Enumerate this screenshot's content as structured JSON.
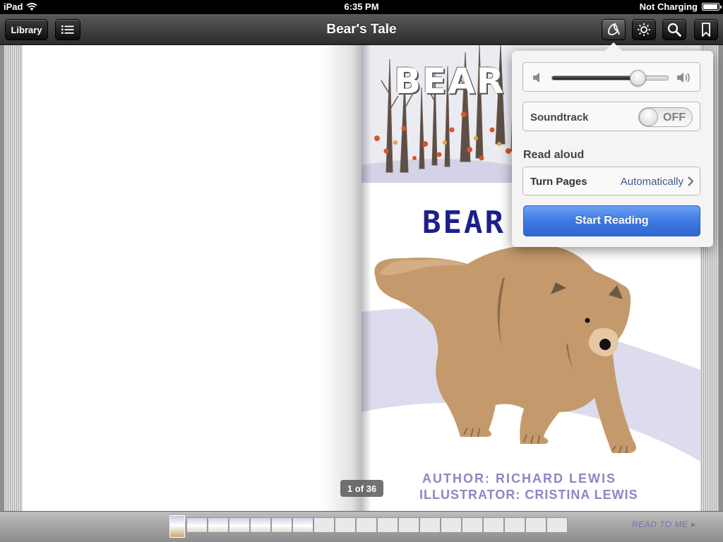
{
  "status_bar": {
    "device": "iPad",
    "time": "6:35 PM",
    "battery_status": "Not Charging"
  },
  "toolbar": {
    "library_label": "Library",
    "book_title": "Bear's Tale",
    "icons": [
      "list-icon",
      "audio-icon",
      "brightness-icon",
      "search-icon",
      "bookmark-icon"
    ]
  },
  "book": {
    "cover_title_top": "BEAR",
    "cover_title_main": "BEAR",
    "author": "AUTHOR: RICHARD LEWIS",
    "illustrator": "ILLUSTRATOR: CRISTINA LEWIS",
    "page_counter": "1 of 36"
  },
  "audio_popover": {
    "volume_level": 0.74,
    "soundtrack_label": "Soundtrack",
    "soundtrack_state": "OFF",
    "read_aloud_label": "Read aloud",
    "turn_pages_label": "Turn Pages",
    "turn_pages_value": "Automatically",
    "start_button": "Start Reading"
  },
  "bottom_bar": {
    "read_to_me": "READ TO ME",
    "thumbnail_count": 19,
    "filled_thumbnails": 7
  },
  "colors": {
    "title_navy": "#1d1f8a",
    "credit_lavender": "#8a88c4",
    "start_button_blue": "#3c76e1",
    "bear_tan": "#c49a6c"
  }
}
